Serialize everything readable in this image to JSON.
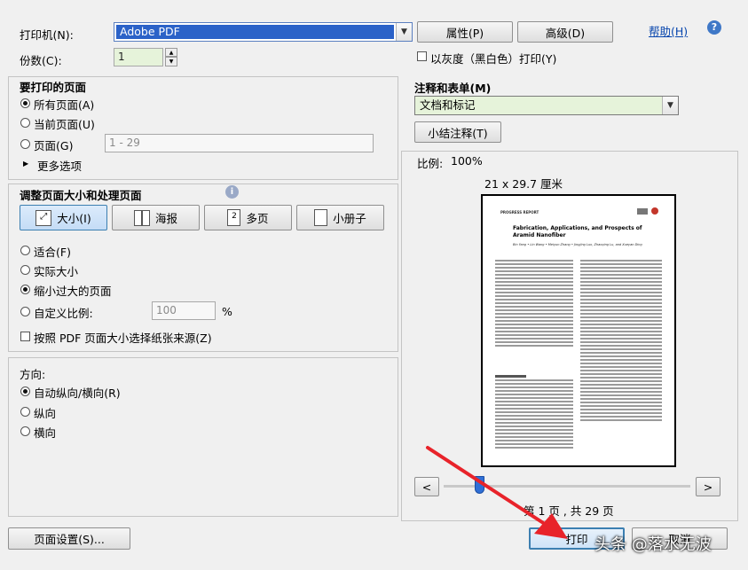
{
  "printer": {
    "printer_label": "打印机(N):",
    "printer_value": "Adobe PDF",
    "properties_label": "属性(P)",
    "advanced_label": "高级(D)",
    "help_label": "帮助(H)",
    "copies_label": "份数(C):",
    "copies_value": "1",
    "grayscale_label": "以灰度（黑白色）打印(Y)"
  },
  "pages_to_print": {
    "title": "要打印的页面",
    "all_pages": "所有页面(A)",
    "current_page": "当前页面(U)",
    "pages": "页面(G)",
    "pages_placeholder": "1 - 29",
    "more_options": "更多选项"
  },
  "sizing": {
    "title": "调整页面大小和处理页面",
    "size_btn": "大小(I)",
    "poster_btn": "海报",
    "multiple_btn": "多页",
    "booklet_btn": "小册子",
    "fit": "适合(F)",
    "actual_size": "实际大小",
    "shrink": "缩小过大的页面",
    "custom_scale": "自定义比例:",
    "custom_scale_value": "100",
    "percent": "%",
    "pdf_paper_source": "按照 PDF 页面大小选择纸张来源(Z)"
  },
  "orientation": {
    "title": "方向:",
    "auto": "自动纵向/横向(R)",
    "portrait": "纵向",
    "landscape": "横向"
  },
  "comments": {
    "title": "注释和表单(M)",
    "value": "文档和标记",
    "summarize_btn": "小结注释(T)"
  },
  "preview": {
    "scale_label": "比例:",
    "scale_value": "100%",
    "page_size": "21 x 29.7 厘米",
    "doc_header": "PROGRESS REPORT",
    "doc_title": "Fabrication, Applications, and Prospects of Aramid Nanofiber",
    "doc_authors": "Bin Yang • Lin Wang • Meiyun Zhang • Jingjing Luo, Zhaoqing Lu, and Xueyan Ding",
    "prev_btn": "<",
    "next_btn": ">",
    "page_text": "第 1 页 , 共 29 页"
  },
  "footer": {
    "page_setup_btn": "页面设置(S)...",
    "print_btn": "打印",
    "cancel_btn": "取消",
    "watermark": "头条 @落水无波"
  },
  "colors": {
    "selection_blue": "#2b62c8",
    "arrow_red": "#e8232a",
    "link_blue": "#0645ad"
  }
}
